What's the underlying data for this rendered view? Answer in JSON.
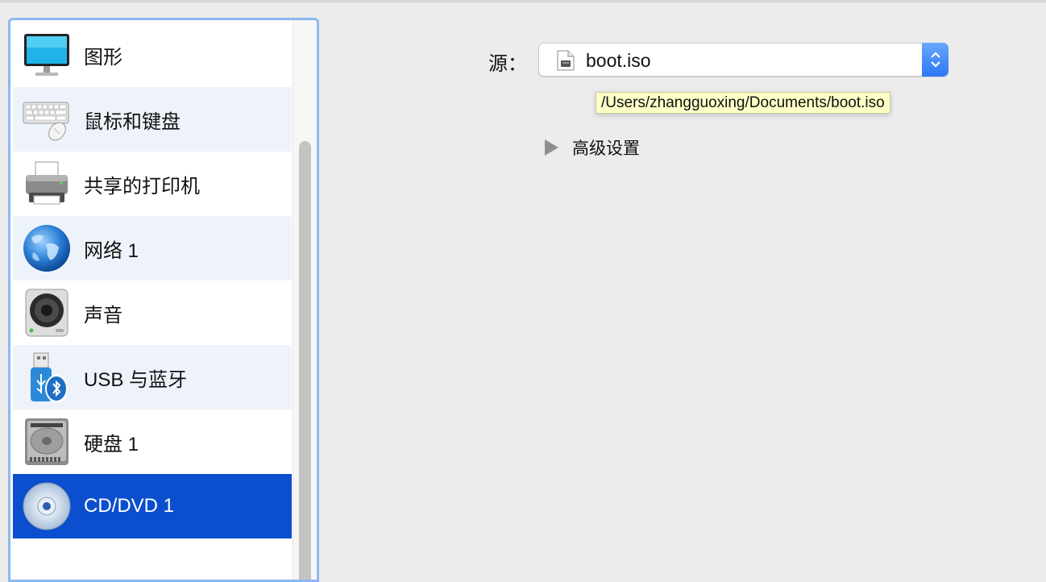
{
  "sidebar": {
    "items": [
      {
        "label": "图形",
        "icon": "monitor-icon"
      },
      {
        "label": "鼠标和键盘",
        "icon": "keyboard-mouse-icon"
      },
      {
        "label": "共享的打印机",
        "icon": "printer-icon"
      },
      {
        "label": "网络 1",
        "icon": "globe-icon"
      },
      {
        "label": "声音",
        "icon": "speaker-icon"
      },
      {
        "label": "USB 与蓝牙",
        "icon": "usb-bluetooth-icon"
      },
      {
        "label": "硬盘 1",
        "icon": "hard-disk-icon"
      },
      {
        "label": "CD/DVD 1",
        "icon": "cd-dvd-icon",
        "selected": true
      }
    ]
  },
  "source": {
    "label": "源：",
    "value": "boot.iso",
    "file_icon": "disk-image-file-icon",
    "tooltip": "/Users/zhangguoxing/Documents/boot.iso"
  },
  "advanced": {
    "label": "高级设置",
    "expanded": false
  },
  "colors": {
    "selection": "#0b4fcf",
    "alt_row": "#eef3fb",
    "focus_ring": "#8db8f0",
    "stepper_blue": "#2b78f3",
    "tooltip_bg": "#ffffc8"
  }
}
